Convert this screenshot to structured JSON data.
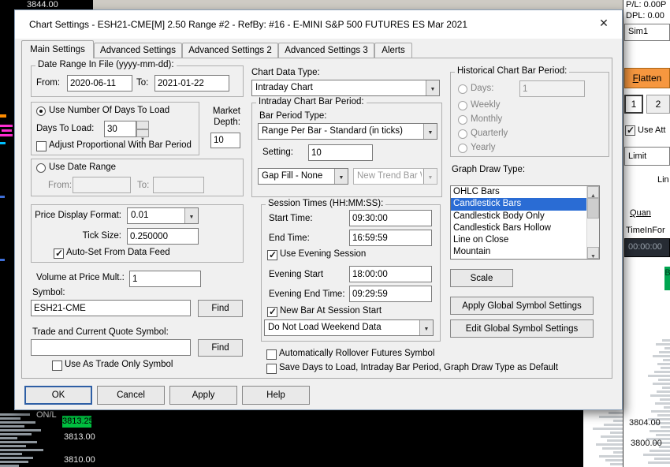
{
  "window": {
    "title": "Chart Settings - ESH21-CME[M]  2.50 Range  #2 - RefBy: #16 - E-MINI S&P 500 FUTURES ES Mar 2021",
    "close": "✕"
  },
  "tabs": [
    {
      "label": "Main Settings"
    },
    {
      "label": "Advanced Settings"
    },
    {
      "label": "Advanced Settings 2"
    },
    {
      "label": "Advanced Settings 3"
    },
    {
      "label": "Alerts"
    }
  ],
  "left": {
    "date_range": {
      "legend": "Date Range In File (yyyy-mm-dd):",
      "from_label": "From:",
      "from_value": "2020-06-11",
      "to_label": "To:",
      "to_value": "2021-01-22"
    },
    "days": {
      "radio": "Use Number Of Days To Load",
      "days_label": "Days To Load:",
      "days_value": "30",
      "adjust": "Adjust Proportional With Bar Period"
    },
    "market_depth": {
      "label": "Market Depth:",
      "value": "10"
    },
    "range_radio": {
      "radio": "Use Date Range",
      "from_label": "From:",
      "to_label": "To:"
    },
    "price": {
      "format_label": "Price Display Format:",
      "format_value": "0.01",
      "tick_label": "Tick Size:",
      "tick_value": "0.250000",
      "autoset": "Auto-Set From Data Feed"
    },
    "volume_mult": {
      "label": "Volume at Price Mult.:",
      "value": "1"
    },
    "symbol": {
      "label": "Symbol:",
      "value": "ESH21-CME",
      "find": "Find"
    },
    "trade_symbol": {
      "label": "Trade and Current Quote Symbol:",
      "value": "",
      "find": "Find",
      "trade_only": "Use As Trade Only Symbol"
    }
  },
  "middle": {
    "chart_data_type": {
      "label": "Chart Data Type:",
      "value": "Intraday Chart"
    },
    "intraday": {
      "legend": "Intraday Chart Bar Period:",
      "bar_period_label": "Bar Period Type:",
      "bar_period_value": "Range Per Bar - Standard (in ticks)",
      "setting_label": "Setting:",
      "setting_value": "10",
      "gap_fill": "Gap Fill - None",
      "new_trend": "New Trend Bar W"
    },
    "session": {
      "legend": "Session Times (HH:MM:SS):",
      "start_label": "Start Time:",
      "start_value": "09:30:00",
      "end_label": "End Time:",
      "end_value": "16:59:59",
      "evening": "Use Evening Session",
      "evening_start_label": "Evening Start",
      "evening_start_value": "18:00:00",
      "evening_end_label": "Evening End Time:",
      "evening_end_value": "09:29:59",
      "new_bar": "New Bar At Session Start",
      "weekend": "Do Not Load Weekend Data"
    },
    "rollover": "Automatically Rollover Futures Symbol",
    "save_default": "Save Days to Load, Intraday Bar Period, Graph Draw Type as Default"
  },
  "right": {
    "historical": {
      "legend": "Historical Chart Bar Period:",
      "days_label": "Days:",
      "days_value": "1",
      "weekly": "Weekly",
      "monthly": "Monthly",
      "quarterly": "Quarterly",
      "yearly": "Yearly"
    },
    "graph_draw": {
      "label": "Graph Draw Type:",
      "items": [
        "OHLC Bars",
        "Candlestick Bars",
        "Candlestick Body Only",
        "Candlestick Bars Hollow",
        "Line on Close",
        "Mountain"
      ],
      "selected": "Candlestick Bars",
      "scale": "Scale",
      "apply_global": "Apply Global Symbol Settings",
      "edit_global": "Edit Global Symbol Settings"
    }
  },
  "buttons": {
    "ok": "OK",
    "cancel": "Cancel",
    "apply": "Apply",
    "help": "Help"
  },
  "chart_bg": {
    "top_price": "3844.00",
    "onl": "ON/L",
    "last_price": "3813.25",
    "price_below": "3813.00",
    "price_bottom": "3810.00",
    "scale_price_1": "3804.00",
    "scale_price_2": "3800.00"
  },
  "trade_panel": {
    "pl": "P/L: 0.00P",
    "dpl": "DPL: 0.00",
    "account": "Sim1",
    "flatten": "Flatten",
    "tab_1": "1",
    "tab_2": "2",
    "use_att": "Use Att",
    "order_type": "Limit",
    "lin": "Lin",
    "quantity": "Quan",
    "tif": "TimeInFor",
    "timer": "00:00:00",
    "buy": "B"
  },
  "colors": {
    "flatten_bg": "#F6973F",
    "last_price_bg": "#00c040",
    "list_selection": "#2a6cd4",
    "buy_green": "#00a651"
  }
}
